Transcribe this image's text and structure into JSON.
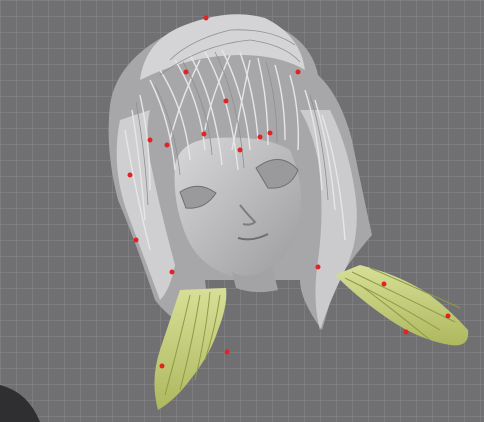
{
  "viewport": {
    "background": "#707073",
    "grid_color": "#8a8a8e",
    "model_color": "#b9b9bb",
    "hair_light": "#dcdcde",
    "hair_dark": "#7d7d80",
    "accent_hair": "#c9d67d",
    "accent_hair_dark": "#8f9a45",
    "marker_color": "#e02424"
  },
  "icons": {
    "grid": "grid-plane",
    "model": "sculpt-head",
    "marker": "point-marker"
  }
}
